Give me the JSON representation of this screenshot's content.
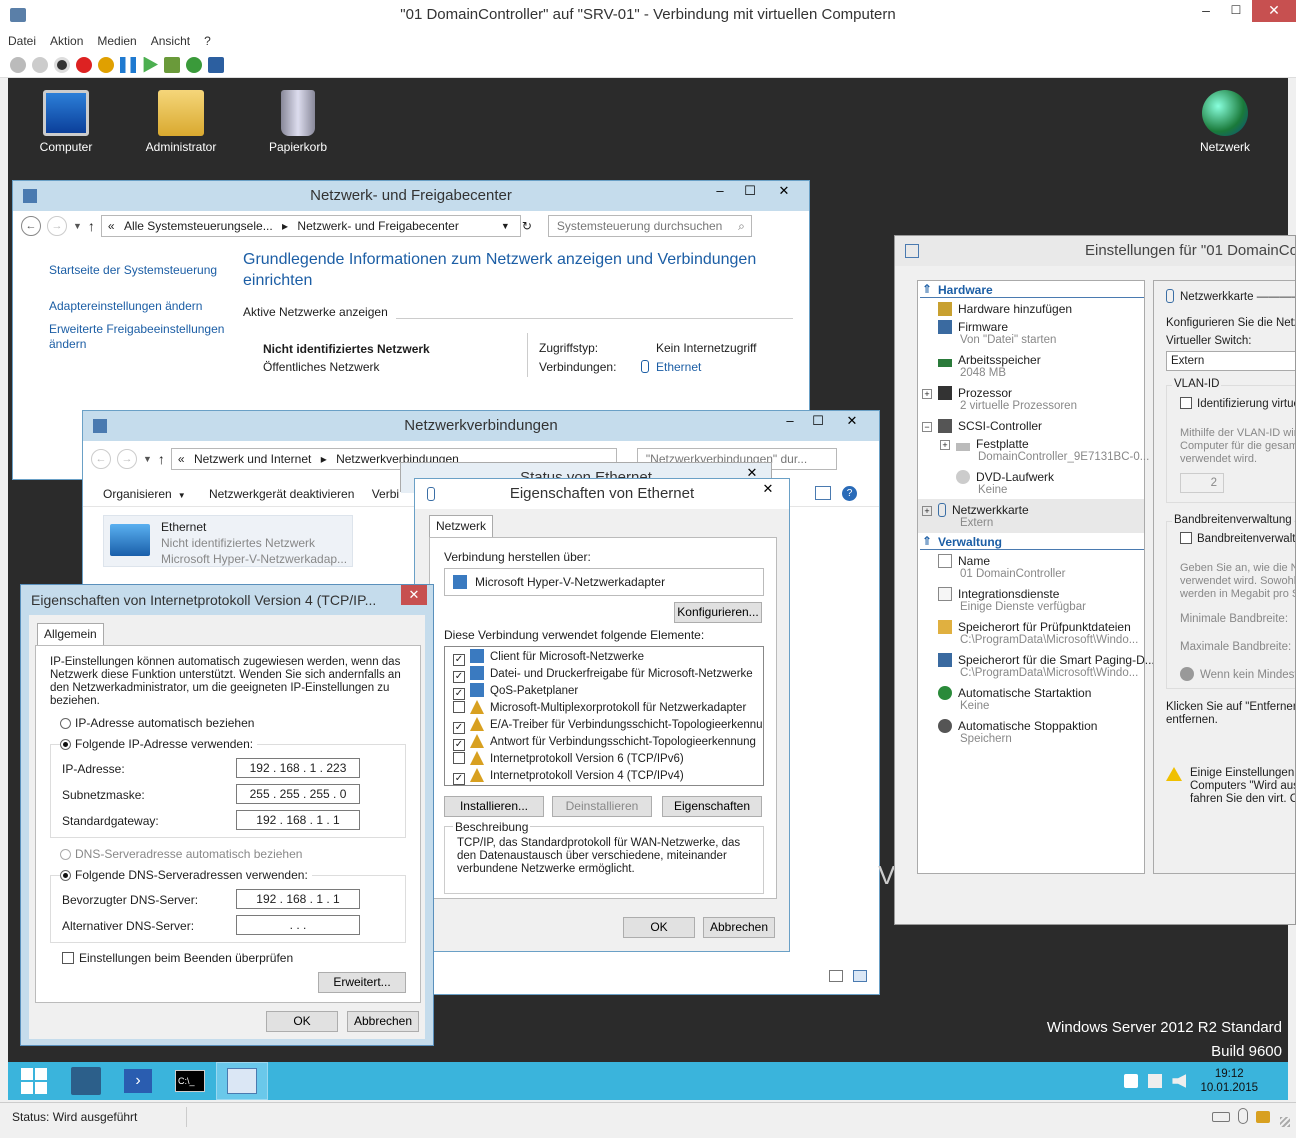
{
  "host": {
    "title": "\"01 DomainController\" auf \"SRV-01\" - Verbindung mit virtuellen Computern",
    "menu": [
      "Datei",
      "Aktion",
      "Medien",
      "Ansicht",
      "?"
    ],
    "status": "Status: Wird ausgeführt"
  },
  "desktop": {
    "icons": [
      "Computer",
      "Administrator",
      "Papierkorb"
    ],
    "right_icon": "Netzwerk",
    "watermark_line1": "Windows Server 2012 R2 Standard",
    "watermark_line2": "Build 9600",
    "clock_time": "19:12",
    "clock_date": "10.01.2015"
  },
  "nsc": {
    "title": "Netzwerk- und Freigabecenter",
    "breadcrumb_prefix": "«",
    "breadcrumb_1": "Alle Systemsteuerungsele...",
    "breadcrumb_2": "Netzwerk- und Freigabecenter",
    "search": "Systemsteuerung durchsuchen",
    "links": [
      "Startseite der Systemsteuerung",
      "Adaptereinstellungen ändern",
      "Erweiterte Freigabeeinstellungen ändern"
    ],
    "heading": "Grundlegende Informationen zum Netzwerk anzeigen und Verbindungen einrichten",
    "section": "Aktive Netzwerke anzeigen",
    "network_name": "Nicht identifiziertes Netzwerk",
    "network_type": "Öffentliches Netzwerk",
    "access_label": "Zugriffstyp:",
    "access_value": "Kein Internetzugriff",
    "conn_label": "Verbindungen:",
    "conn_value": "Ethernet"
  },
  "nc": {
    "title": "Netzwerkverbindungen",
    "breadcrumb_prefix": "«",
    "breadcrumb_1": "Netzwerk und Internet",
    "breadcrumb_2": "Netzwerkverbindungen",
    "search": "\"Netzwerkverbindungen\" dur...",
    "toolbar": [
      "Organisieren",
      "Netzwerkgerät deaktivieren",
      "Verbi"
    ],
    "adapter_name": "Ethernet",
    "adapter_net": "Nicht identifiziertes Netzwerk",
    "adapter_device": "Microsoft Hyper-V-Netzwerkadap..."
  },
  "status_eth": {
    "title": "Status von Ethernet"
  },
  "eth": {
    "title": "Eigenschaften von Ethernet",
    "tab": "Netzwerk",
    "connect_label": "Verbindung herstellen über:",
    "adapter": "Microsoft Hyper-V-Netzwerkadapter",
    "configure": "Konfigurieren...",
    "items_label": "Diese Verbindung verwendet folgende Elemente:",
    "items": [
      {
        "label": "Client für Microsoft-Netzwerke",
        "checked": true
      },
      {
        "label": "Datei- und Druckerfreigabe für Microsoft-Netzwerke",
        "checked": true
      },
      {
        "label": "QoS-Paketplaner",
        "checked": true
      },
      {
        "label": "Microsoft-Multiplexorprotokoll für Netzwerkadapter",
        "checked": false
      },
      {
        "label": "E/A-Treiber für Verbindungsschicht-Topologieerkennun...",
        "checked": true
      },
      {
        "label": "Antwort für Verbindungsschicht-Topologieerkennung",
        "checked": true
      },
      {
        "label": "Internetprotokoll Version 6 (TCP/IPv6)",
        "checked": false
      },
      {
        "label": "Internetprotokoll Version 4 (TCP/IPv4)",
        "checked": true
      }
    ],
    "install": "Installieren...",
    "uninstall": "Deinstallieren",
    "properties": "Eigenschaften",
    "desc_label": "Beschreibung",
    "desc": "TCP/IP, das Standardprotokoll für WAN-Netzwerke, das den Datenaustausch über verschiedene, miteinander verbundene Netzwerke ermöglicht.",
    "ok": "OK",
    "cancel": "Abbrechen"
  },
  "ipv4": {
    "title": "Eigenschaften von Internetprotokoll Version 4 (TCP/IP...",
    "tab": "Allgemein",
    "intro": "IP-Einstellungen können automatisch zugewiesen werden, wenn das Netzwerk diese Funktion unterstützt. Wenden Sie sich andernfalls an den Netzwerkadministrator, um die geeigneten IP-Einstellungen zu beziehen.",
    "auto_ip": "IP-Adresse automatisch beziehen",
    "manual_ip": "Folgende IP-Adresse verwenden:",
    "ip_label": "IP-Adresse:",
    "ip_value": "192 . 168 .  1  . 223",
    "mask_label": "Subnetzmaske:",
    "mask_value": "255 . 255 . 255 .  0",
    "gw_label": "Standardgateway:",
    "gw_value": "192 . 168 .  1  .  1",
    "auto_dns": "DNS-Serveradresse automatisch beziehen",
    "manual_dns": "Folgende DNS-Serveradressen verwenden:",
    "dns1_label": "Bevorzugter DNS-Server:",
    "dns1_value": "192 . 168 .  1  .  1",
    "dns2_label": "Alternativer DNS-Server:",
    "dns2_value": " .    .    . ",
    "validate": "Einstellungen beim Beenden überprüfen",
    "advanced": "Erweitert...",
    "ok": "OK",
    "cancel": "Abbrechen"
  },
  "vmset": {
    "title": "Einstellungen für \"01 DomainCo",
    "hardware": "Hardware",
    "tree": [
      {
        "label": "Hardware hinzufügen",
        "sub": ""
      },
      {
        "label": "Firmware",
        "sub": "Von \"Datei\" starten"
      },
      {
        "label": "Arbeitsspeicher",
        "sub": "2048 MB"
      },
      {
        "label": "Prozessor",
        "sub": "2 virtuelle Prozessoren"
      },
      {
        "label": "SCSI-Controller",
        "sub": ""
      },
      {
        "label": "Festplatte",
        "sub": "DomainController_9E7131BC-0..."
      },
      {
        "label": "DVD-Laufwerk",
        "sub": "Keine"
      },
      {
        "label": "Netzwerkkarte",
        "sub": "Extern"
      }
    ],
    "management": "Verwaltung",
    "mgmt_tree": [
      {
        "label": "Name",
        "sub": "01 DomainController"
      },
      {
        "label": "Integrationsdienste",
        "sub": "Einige Dienste verfügbar"
      },
      {
        "label": "Speicherort für Prüfpunktdateien",
        "sub": "C:\\ProgramData\\Microsoft\\Windo..."
      },
      {
        "label": "Speicherort für die Smart Paging-D...",
        "sub": "C:\\ProgramData\\Microsoft\\Windo..."
      },
      {
        "label": "Automatische Startaktion",
        "sub": "Keine"
      },
      {
        "label": "Automatische Stoppaktion",
        "sub": "Speichern"
      }
    ],
    "panel_title": "Netzwerkkarte",
    "configure": "Konfigurieren Sie die Netzw",
    "vswitch_label": "Virtueller Switch:",
    "vswitch_value": "Extern",
    "vlan_label": "VLAN-ID",
    "vlan_check": "Identifizierung virtue",
    "vlan_help": "Mithilfe der VLAN-ID wird Computer für die gesamt verwendet wird.",
    "vlan_value": "2",
    "bw_label": "Bandbreitenverwaltung",
    "bw_check": "Bandbreitenverwaltu",
    "bw_help": "Geben Sie an, wie die Ne verwendet wird. Sowohl werden in Megabit pro S",
    "bw_min": "Minimale Bandbreite:",
    "bw_max": "Maximale Bandbreite:",
    "bw_info": "Wenn kein Mindest-",
    "remove_text": "Klicken Sie auf \"Entfernen\", entfernen.",
    "warn_text": "Einige Einstellungen kö Computers \"Wird ausg fahren Sie den virt. Co"
  }
}
